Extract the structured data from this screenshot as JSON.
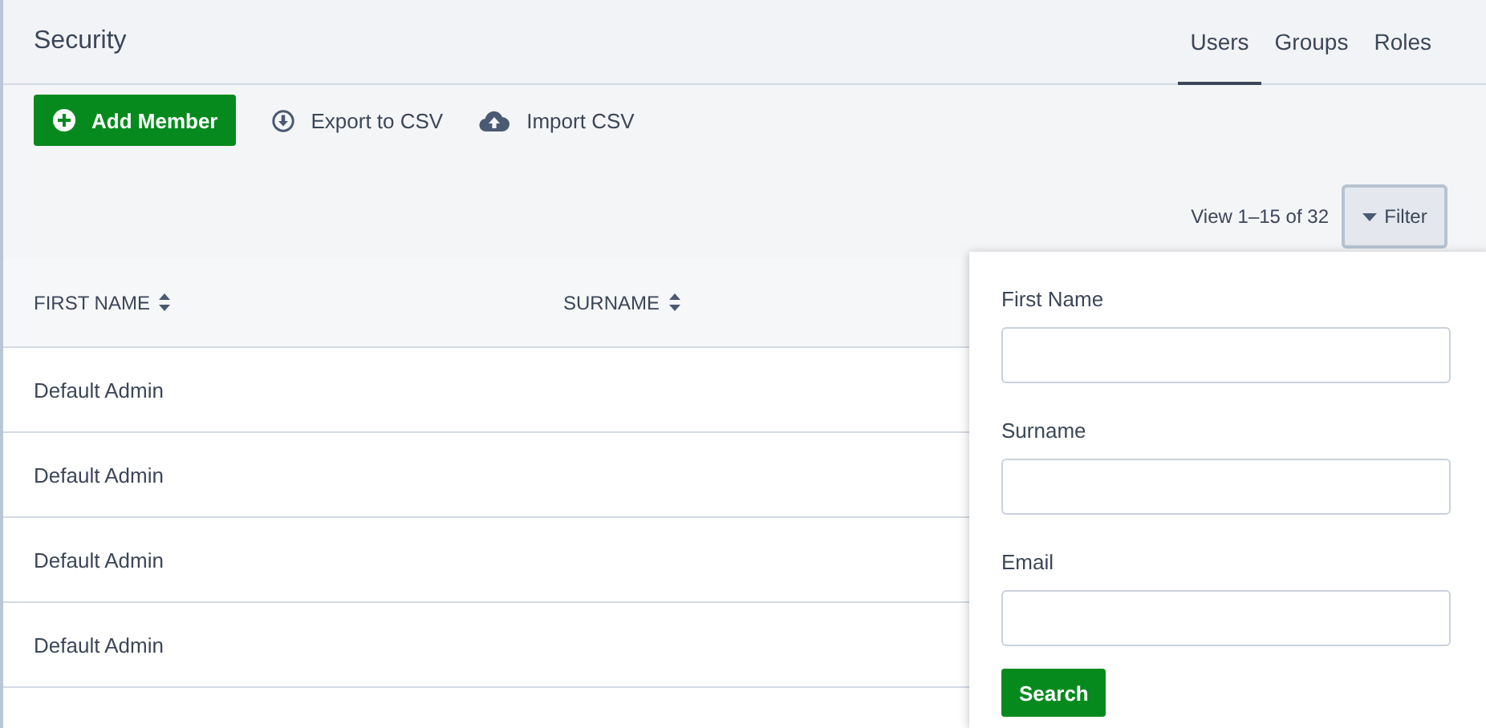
{
  "header": {
    "title": "Security",
    "tabs": [
      {
        "label": "Users",
        "selected": true
      },
      {
        "label": "Groups",
        "selected": false
      },
      {
        "label": "Roles",
        "selected": false
      }
    ]
  },
  "toolbar": {
    "add_button": "Add Member",
    "actions": [
      {
        "kind": "export",
        "label": "Export to CSV"
      },
      {
        "kind": "import",
        "label": "Import CSV"
      }
    ]
  },
  "pagination": {
    "summary": "View 1–15 of 32",
    "filter_button": "Filter",
    "filter_open": true
  },
  "table": {
    "columns": [
      "FIRST NAME",
      "SURNAME"
    ],
    "rows": [
      {
        "first_name": "Default Admin"
      },
      {
        "first_name": "Default Admin"
      },
      {
        "first_name": "Default Admin"
      },
      {
        "first_name": "Default Admin"
      }
    ]
  },
  "filter_panel": {
    "fields": [
      {
        "label": "First Name"
      },
      {
        "label": "Surname"
      },
      {
        "label": "Email"
      }
    ],
    "search_button": "Search"
  }
}
